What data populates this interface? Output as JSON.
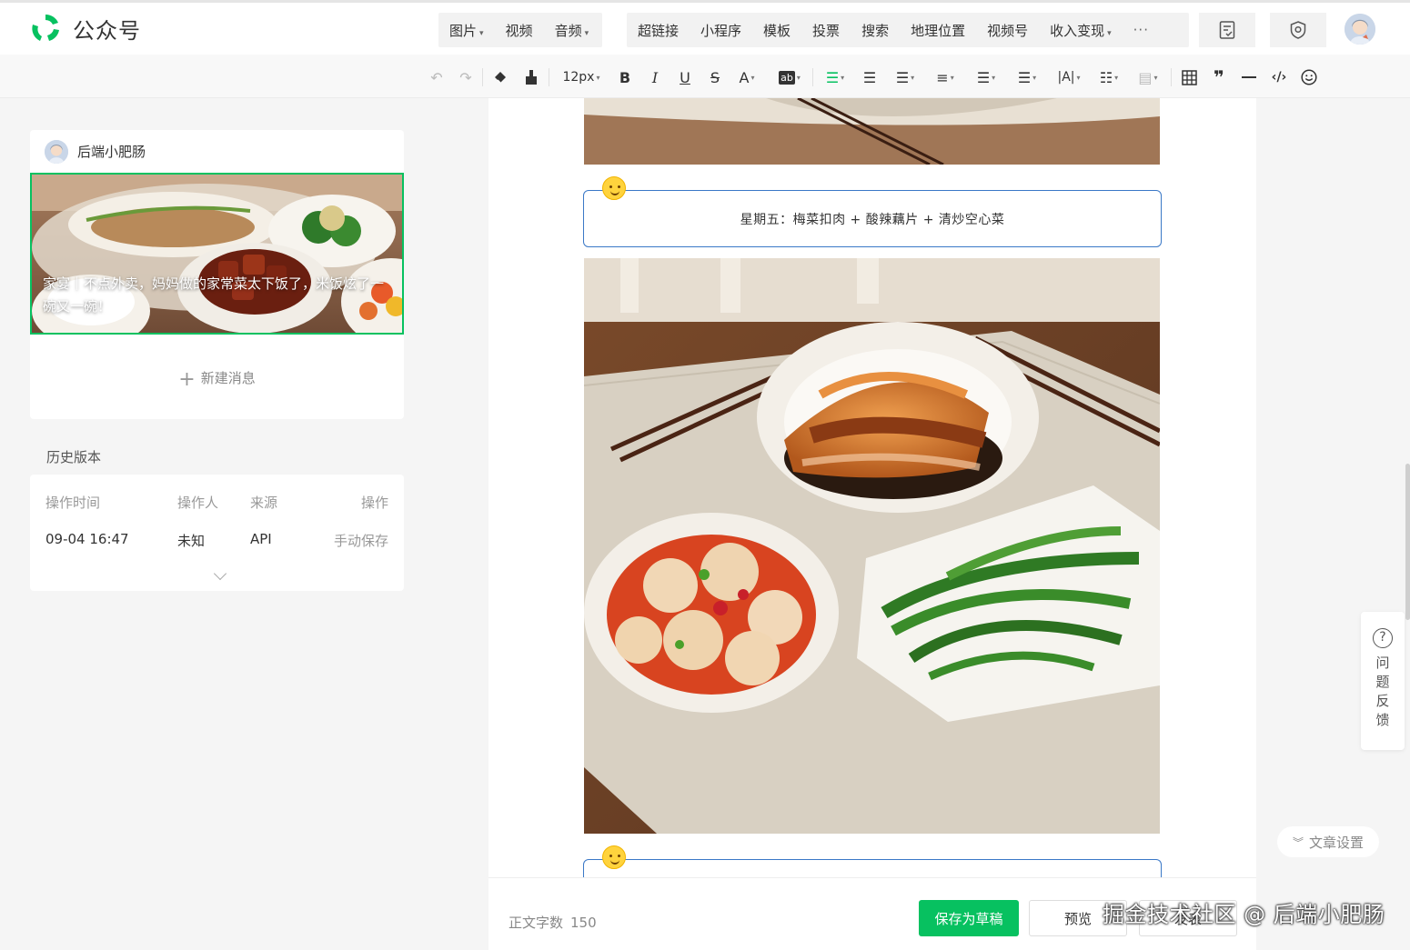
{
  "app": {
    "name": "公众号"
  },
  "header": {
    "media_group": [
      {
        "label": "图片",
        "caret": true
      },
      {
        "label": "视频",
        "caret": false
      },
      {
        "label": "音频",
        "caret": true
      }
    ],
    "insert_group": [
      {
        "label": "超链接",
        "caret": false
      },
      {
        "label": "小程序",
        "caret": false
      },
      {
        "label": "模板",
        "caret": false
      },
      {
        "label": "投票",
        "caret": false
      },
      {
        "label": "搜索",
        "caret": false
      },
      {
        "label": "地理位置",
        "caret": false
      },
      {
        "label": "视频号",
        "caret": false
      },
      {
        "label": "收入变现",
        "caret": true
      }
    ],
    "more_label": "···"
  },
  "toolbar": {
    "font_size": "12px",
    "bold": "B",
    "italic": "I",
    "underline": "U",
    "strike": "S",
    "font_color": "A",
    "bg_color": "ab",
    "line_height": "|A|"
  },
  "account": {
    "name": "后端小肥肠",
    "article_title": "家宴｜不点外卖，妈妈做的家常菜太下饭了，米饭炫了一碗又一碗！",
    "new_message": "新建消息"
  },
  "history": {
    "title": "历史版本",
    "columns": [
      "操作时间",
      "操作人",
      "来源",
      "操作"
    ],
    "rows": [
      {
        "time": "09-04 16:47",
        "operator": "未知",
        "source": "API",
        "action": "手动保存"
      }
    ]
  },
  "editor": {
    "caption": "星期五：梅菜扣肉 + 酸辣藕片 + 清炒空心菜"
  },
  "footer": {
    "word_count_label": "正文字数",
    "word_count": "150",
    "save_label": "保存为草稿",
    "preview_label": "预览",
    "publish_label": "发表"
  },
  "side": {
    "feedback_label": "问题反馈",
    "settings_label": "文章设置"
  },
  "watermark": "掘金技术社区 @ 后端小肥肠",
  "colors": {
    "accent": "#07c160",
    "caption_border": "#3a78c7"
  }
}
